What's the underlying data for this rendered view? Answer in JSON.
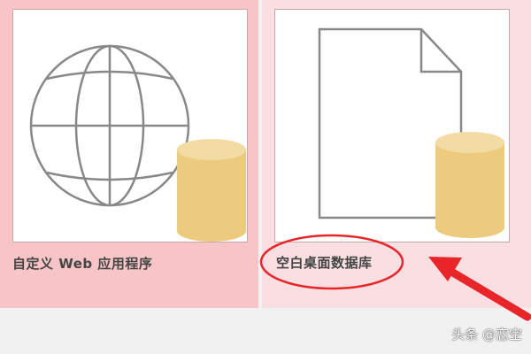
{
  "templates": [
    {
      "label": "自定义 Web 应用程序",
      "icon": "globe-database-icon"
    },
    {
      "label": "空白桌面数据库",
      "icon": "blank-document-database-icon"
    }
  ],
  "watermark": "头条 @恋空",
  "colors": {
    "selected_card_bg": "#f7c5c8",
    "hover_card_bg": "#f9dfe1",
    "database_fill": "#eccb7f",
    "annotation_red": "#e8262a",
    "icon_stroke": "#888888"
  }
}
